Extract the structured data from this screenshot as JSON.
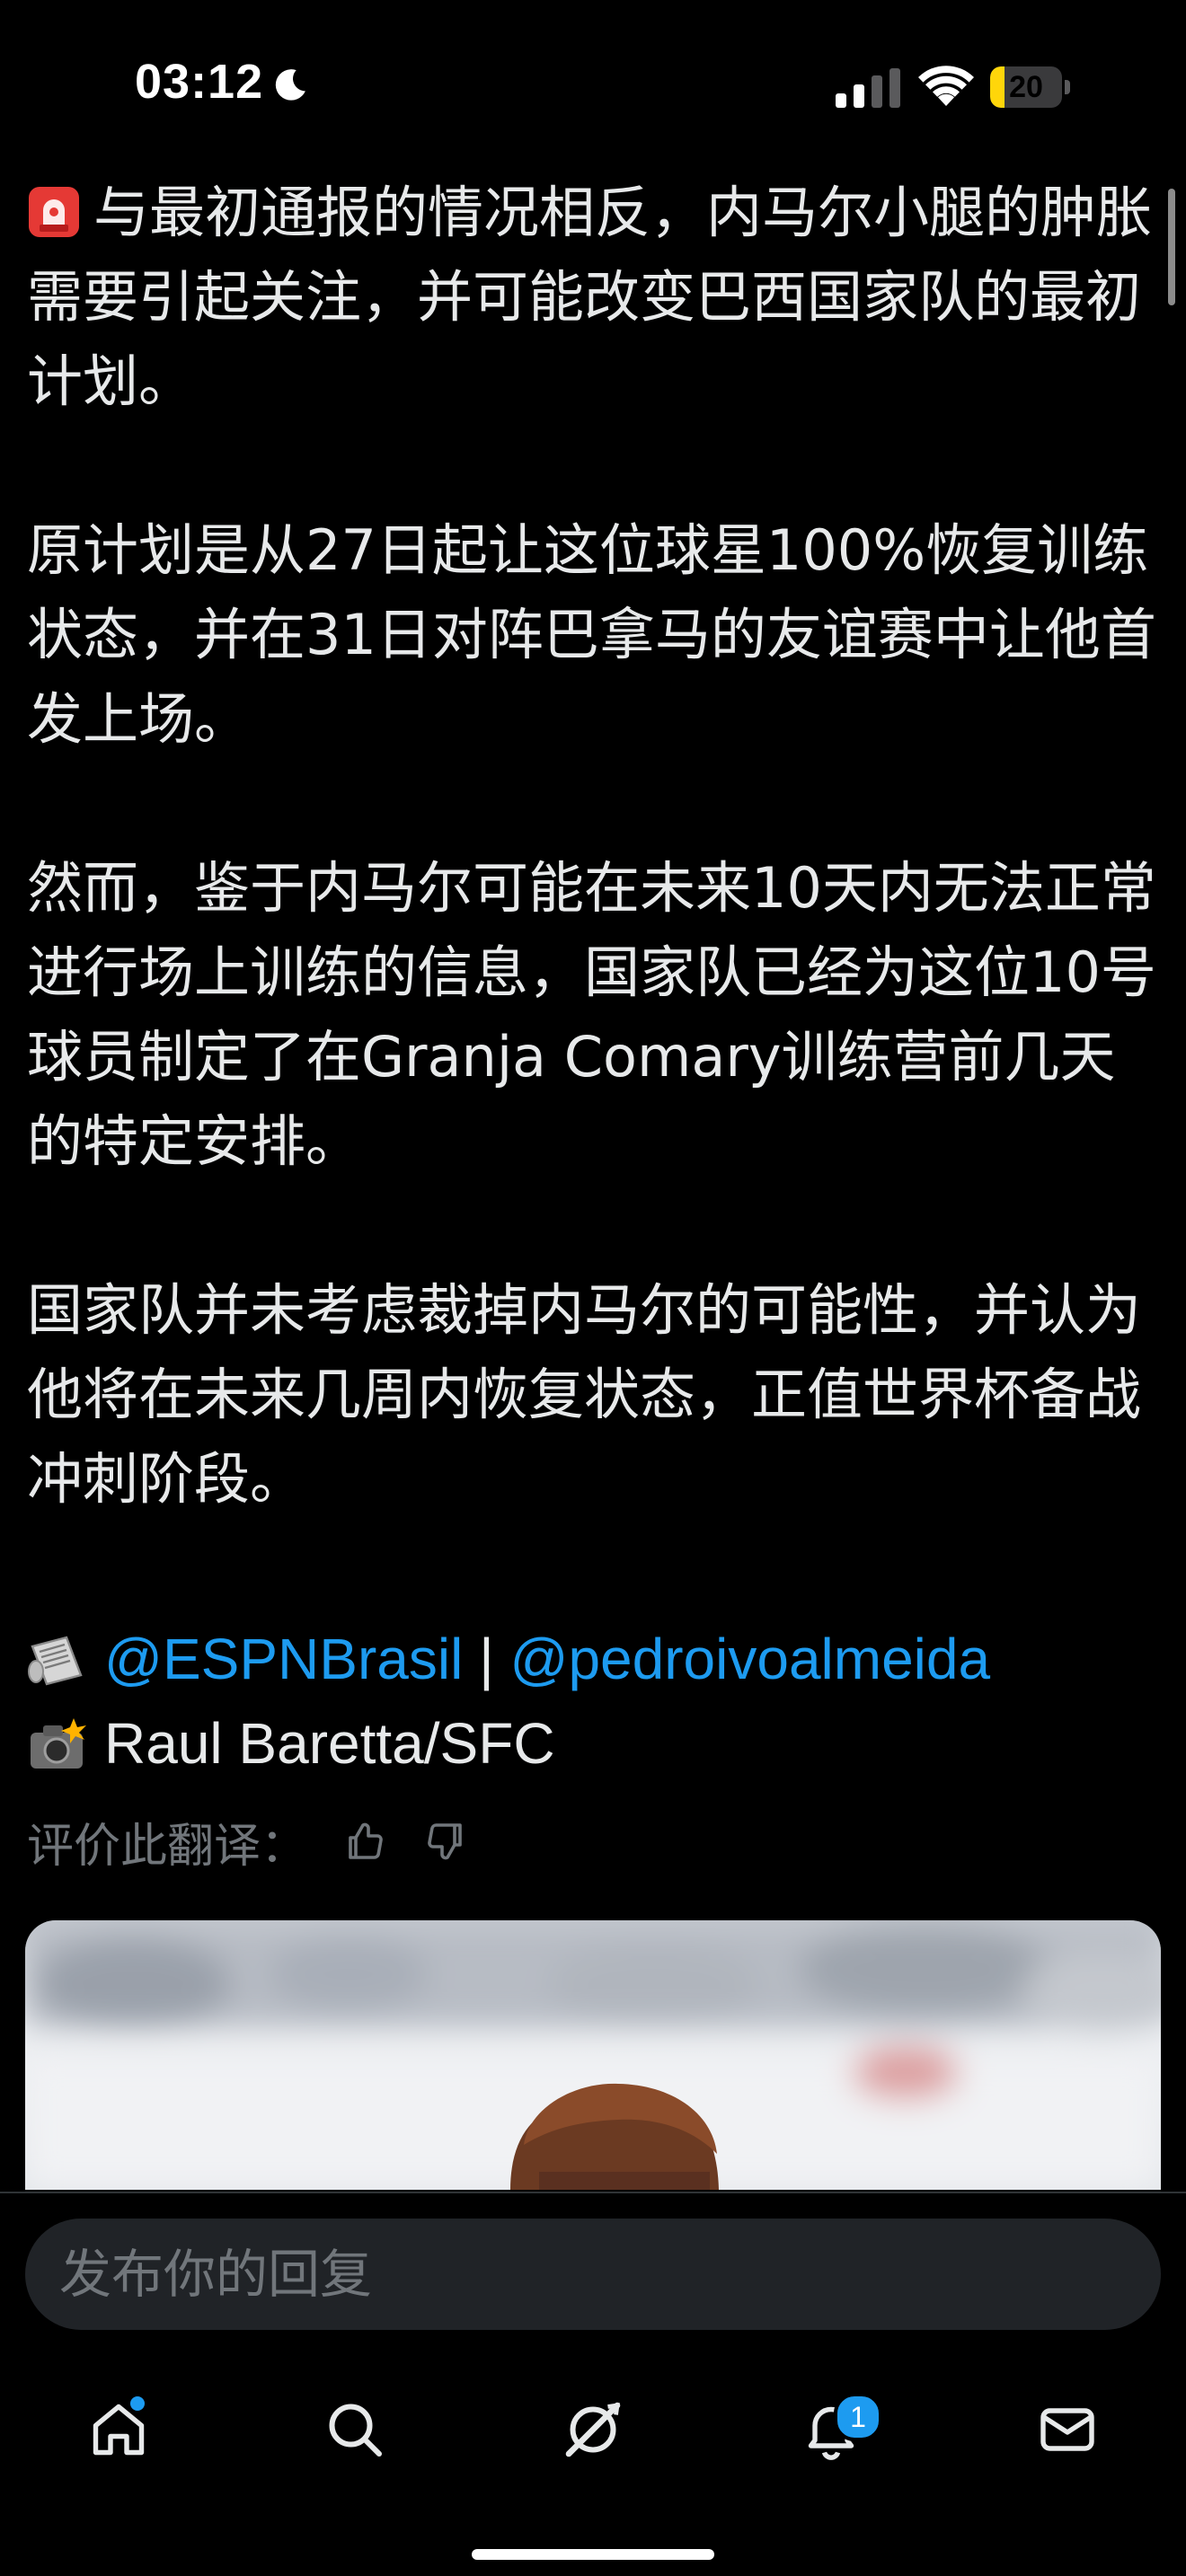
{
  "status_bar": {
    "time": "03:12",
    "battery": "20",
    "battery_level": 0.2,
    "icons": [
      "moon-icon",
      "cellular-signal-icon",
      "wifi-icon",
      "battery-icon"
    ]
  },
  "tweet": {
    "paragraphs": [
      "与最初通报的情况相反，内马尔小腿的肿胀需要引起关注，并可能改变巴西国家队的最初计划。",
      "原计划是从27日起让这位球星100%恢复训练状态，并在31日对阵巴拿马的友谊赛中让他首发上场。",
      "然而，鉴于内马尔可能在未来10天内无法正常进行场上训练的信息，国家队已经为这位10号球员制定了在Granja Comary训练营前几天的特定安排。",
      "国家队并未考虑裁掉内马尔的可能性，并认为他将在未来几周内恢复状态，正值世界杯备战冲刺阶段。"
    ],
    "source_mention_1": "@ESPNBrasil",
    "source_separator": " | ",
    "source_mention_2": "@pedroivoalmeida",
    "photo_credit": "Raul Baretta/SFC",
    "rate_translation_label": "评价此翻译："
  },
  "reply": {
    "placeholder": "发布你的回复"
  },
  "bottom_nav": {
    "items": [
      "home",
      "search",
      "grok",
      "notifications",
      "messages"
    ],
    "notification_count": "1"
  },
  "colors": {
    "background": "#000000",
    "text": "#e7e9ea",
    "muted": "#71767b",
    "accent": "#1d9bf0",
    "battery": "#ffd60a"
  }
}
